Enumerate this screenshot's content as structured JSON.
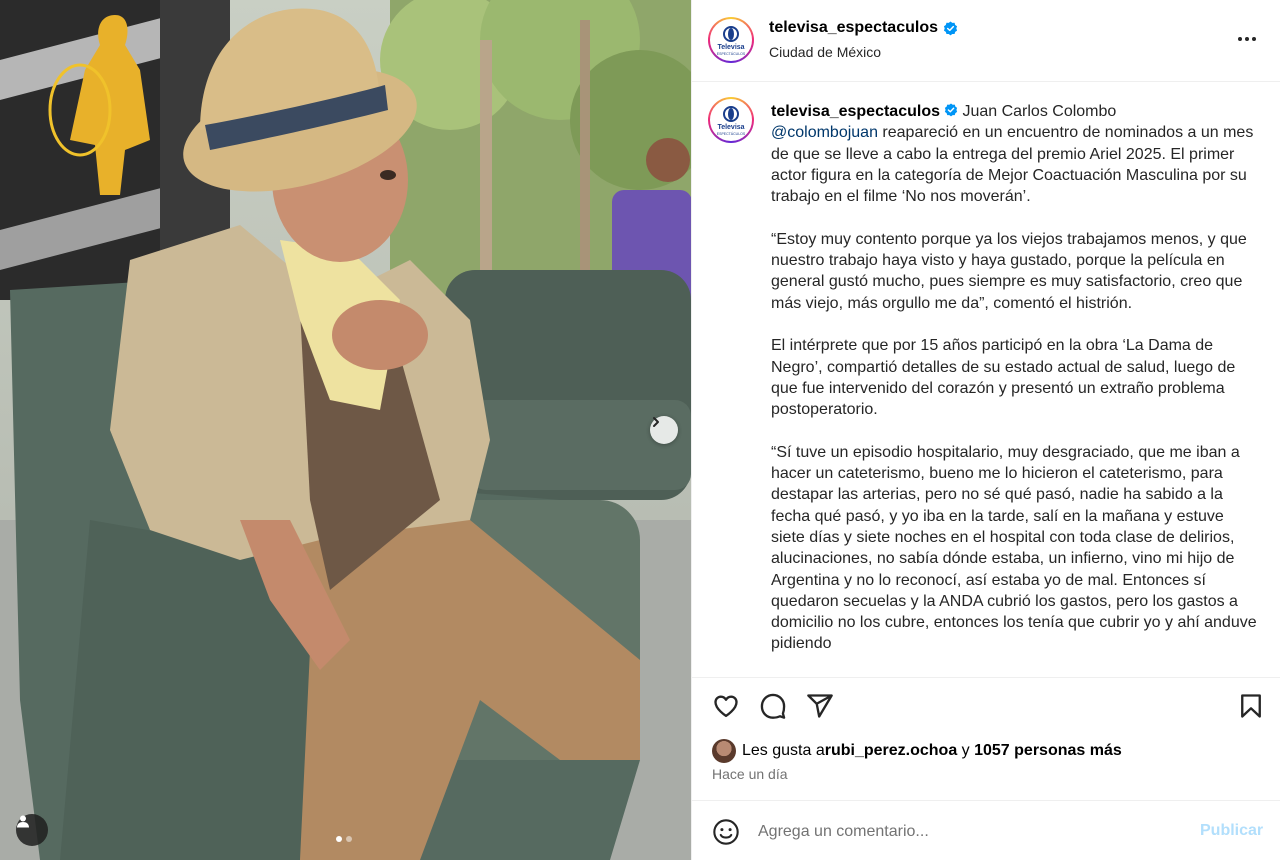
{
  "post": {
    "username": "televisa_espectaculos",
    "location": "Ciudad de México",
    "verified": true,
    "avatar_brand": "Televisa",
    "avatar_subtext": "ESPECTÁCULOS"
  },
  "caption": {
    "username": "televisa_espectaculos",
    "lead": " Juan Carlos Colombo",
    "mention": "@colombojuan",
    "para1": " reapareció en un encuentro de nominados a un mes de que se lleve a cabo la entrega del premio Ariel 2025. El primer actor figura en la categoría de Mejor Coactuación Masculina por su trabajo en el filme ‘No nos moverán’.",
    "para2": "“Estoy muy contento porque ya los viejos trabajamos menos, y que nuestro trabajo haya visto y haya gustado, porque la película en general gustó mucho, pues siempre es muy satisfactorio, creo que más viejo, más orgullo me da”, comentó el histrión.",
    "para3": "El intérprete que por 15 años participó en la obra ‘La Dama de Negro’, compartió detalles de su estado actual de salud, luego de que fue intervenido del corazón y presentó un extraño problema postoperatorio.",
    "para4": "“Sí tuve un episodio hospitalario, muy desgraciado, que me iban a hacer un cateterismo, bueno me lo hicieron el cateterismo, para destapar las arterias, pero no sé qué pasó, nadie ha sabido a la fecha qué pasó, y yo iba en la tarde, salí en la mañana y estuve siete días y siete noches en el hospital con toda clase de delirios, alucinaciones, no sabía dónde estaba, un infierno, vino mi hijo de Argentina y no lo reconocí, así estaba yo de mal. Entonces sí quedaron secuelas y la ANDA cubrió los gastos, pero los gastos a domicilio no los cubre, entonces los tenía que cubrir yo y ahí anduve pidiendo"
  },
  "likes": {
    "prefix": "Les gusta a ",
    "user": "rubi_perez.ochoa",
    "middle": " y ",
    "count": "1057 personas más"
  },
  "time": "Hace un día",
  "comment": {
    "placeholder": "Agrega un comentario...",
    "publish": "Publicar"
  },
  "carousel": {
    "current": 1,
    "total": 2
  },
  "colors": {
    "mention": "#00376b",
    "verified": "#0095f6",
    "publish_disabled": "#b2dffc"
  },
  "icons": [
    "more-icon",
    "heart-icon",
    "comment-icon",
    "share-icon",
    "bookmark-icon",
    "emoji-icon",
    "user-tag-icon",
    "chevron-right-icon",
    "verified-icon"
  ]
}
